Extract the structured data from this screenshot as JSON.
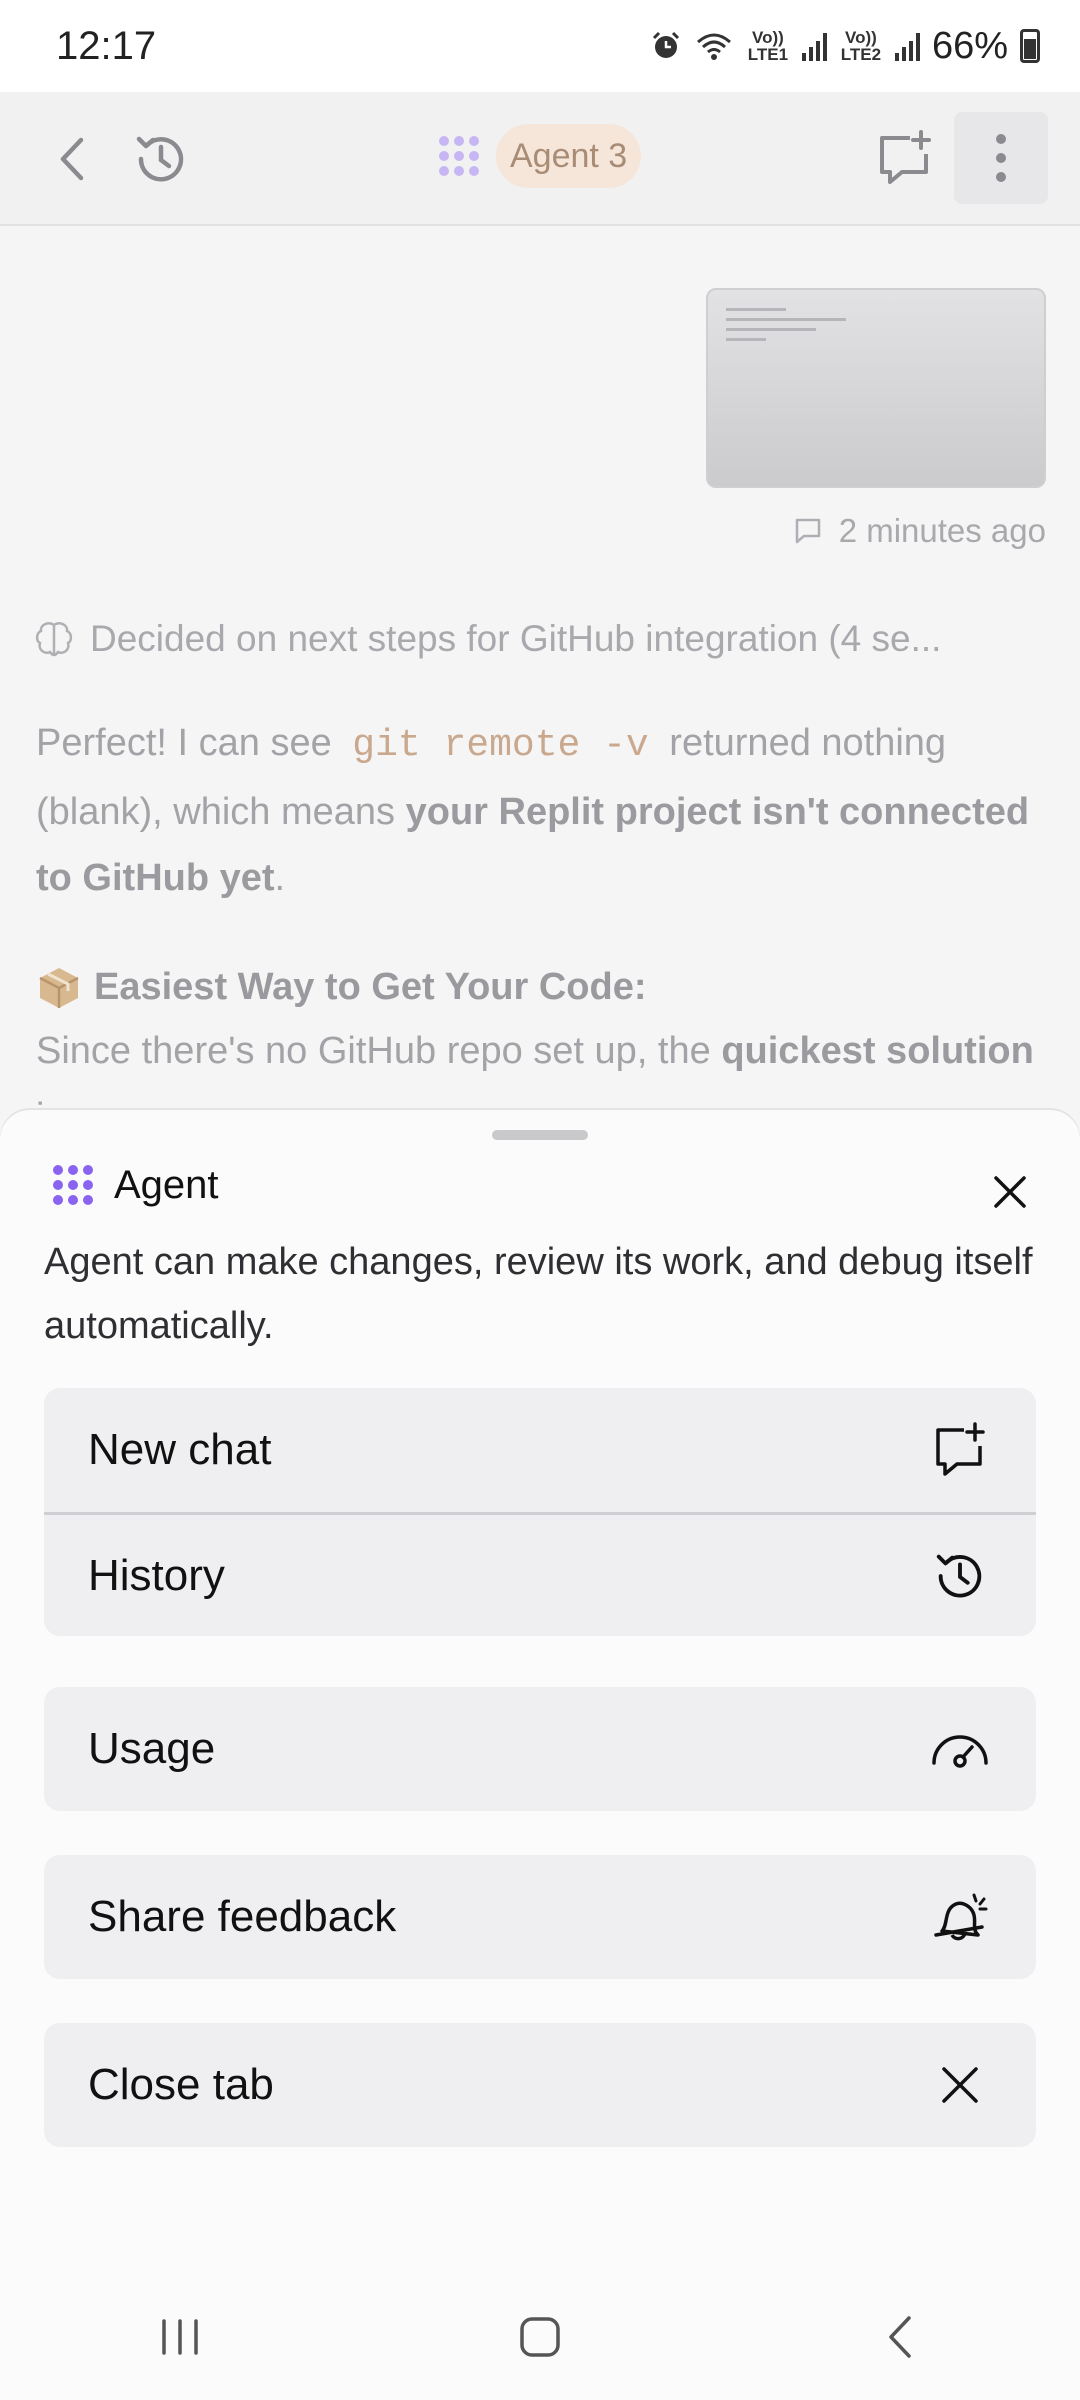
{
  "status_bar": {
    "time": "12:17",
    "sim1": "Vo)) LTE1",
    "sim2": "Vo)) LTE2",
    "battery": "66%"
  },
  "header": {
    "agent_label": "Agent 3",
    "icons": [
      "back-icon",
      "history-icon",
      "agent-logo-icon",
      "new-chat-icon",
      "more-vert-icon"
    ]
  },
  "chat": {
    "timestamp": "2 minutes ago",
    "thought": "Decided on next steps for GitHub integration (4 se...",
    "p1_pre": "Perfect! I can see",
    "p1_code": "git remote -v",
    "p1_mid": "returned nothing (blank), which means",
    "p1_bold": "your Replit project isn't connected to GitHub yet",
    "p1_end": ".",
    "heading": "Easiest Way to Get Your Code:",
    "p2_pre": "Since there's no GitHub repo set up, the",
    "p2_bold": "quickest solution",
    "p2_end": "is:"
  },
  "sheet": {
    "title": "Agent",
    "description": "Agent can make changes, review its work, and debug itself automatically.",
    "group1": [
      {
        "label": "New chat",
        "icon": "new-chat-icon"
      },
      {
        "label": "History",
        "icon": "history-icon"
      }
    ],
    "usage": {
      "label": "Usage",
      "icon": "gauge-icon"
    },
    "feedback": {
      "label": "Share feedback",
      "icon": "bell-sparkle-icon"
    },
    "close_tab": {
      "label": "Close tab",
      "icon": "close-icon"
    }
  },
  "colors": {
    "accent_purple": "#8a63f0",
    "pill_bg": "#f6e6da",
    "pill_text": "#a98c76",
    "sheet_bg": "#fbfbfb",
    "menu_bg": "#efeff1"
  }
}
